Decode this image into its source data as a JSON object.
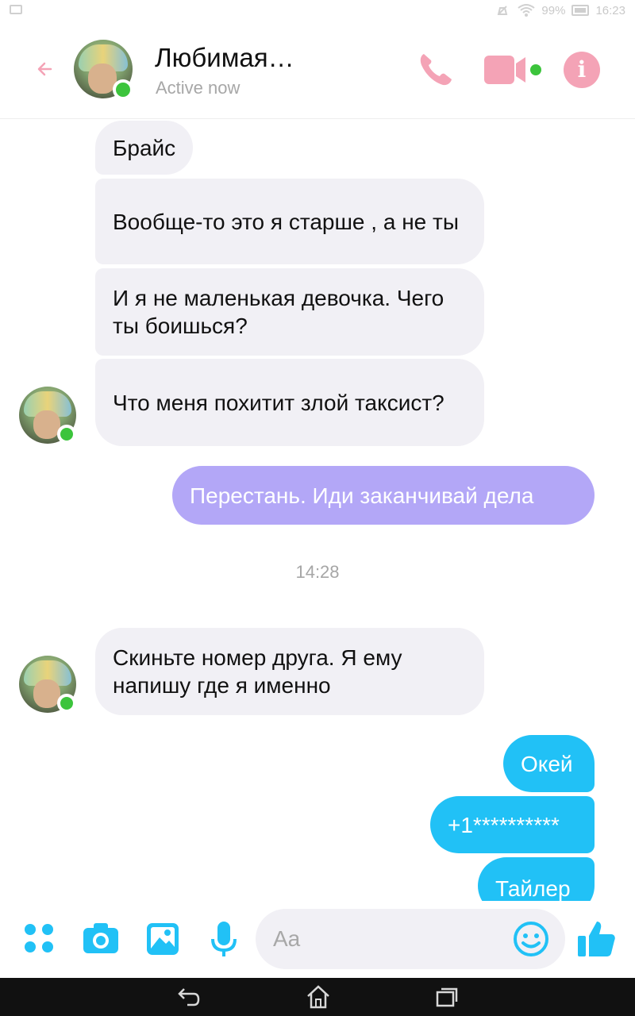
{
  "status_bar": {
    "battery_percent": "99%",
    "time": "16:23"
  },
  "header": {
    "contact_name": "Любимая…",
    "status": "Active now",
    "colors": {
      "accent": "#f4a3b6",
      "online": "#3cc43c"
    },
    "icons": [
      "back-arrow-icon",
      "phone-icon",
      "video-camera-icon",
      "info-icon"
    ]
  },
  "messages": [
    {
      "direction": "incoming",
      "text": "Брайс"
    },
    {
      "direction": "incoming",
      "text": "Вообще-то это я старше , а не ты"
    },
    {
      "direction": "incoming",
      "text": "И я не маленькая девочка. Чего ты боишься?"
    },
    {
      "direction": "incoming",
      "text": "Что меня похитит злой таксист?"
    },
    {
      "direction": "outgoing",
      "text": "Перестань. Иди заканчивай дела"
    },
    {
      "type": "timestamp",
      "text": "14:28"
    },
    {
      "direction": "incoming",
      "text": "Скиньте номер друга. Я ему напишу где я именно"
    },
    {
      "direction": "outgoing",
      "text": "Окей"
    },
    {
      "direction": "outgoing",
      "text": "+1**********"
    },
    {
      "direction": "outgoing",
      "text": "Тайлер"
    }
  ],
  "composer": {
    "placeholder": "Aa",
    "accent": "#21c1f6",
    "icons": [
      "apps-dots-icon",
      "camera-icon",
      "gallery-icon",
      "microphone-icon",
      "emoji-icon",
      "thumbs-up-icon"
    ]
  },
  "nav": {
    "icons": [
      "nav-back-icon",
      "nav-home-icon",
      "nav-recents-icon"
    ]
  }
}
